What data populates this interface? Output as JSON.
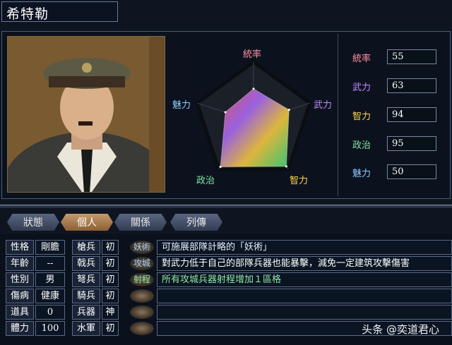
{
  "character": {
    "name": "希特勒"
  },
  "radar": {
    "labels": {
      "top": "統率",
      "right": "武力",
      "bottom_right": "智力",
      "bottom_left": "政治",
      "left": "魅力"
    },
    "label_colors": {
      "top": "#ff8fa3",
      "right": "#c08cff",
      "bottom_right": "#ffd54a",
      "bottom_left": "#7fe8a6",
      "left": "#8fcaff"
    },
    "max": 100,
    "values": [
      55,
      63,
      94,
      95,
      50
    ]
  },
  "stats": [
    {
      "label": "統率",
      "value": "55",
      "color": "#ff8fa3"
    },
    {
      "label": "武力",
      "value": "63",
      "color": "#c08cff"
    },
    {
      "label": "智力",
      "value": "94",
      "color": "#ffd54a"
    },
    {
      "label": "政治",
      "value": "95",
      "color": "#7fe8a6"
    },
    {
      "label": "魅力",
      "value": "50",
      "color": "#8fcaff"
    }
  ],
  "tabs": [
    "狀態",
    "個人",
    "關係",
    "列傳"
  ],
  "active_tab": "個人",
  "personal": [
    {
      "k": "性格",
      "v": "剛膽"
    },
    {
      "k": "年齡",
      "v": "--"
    },
    {
      "k": "性別",
      "v": "男"
    },
    {
      "k": "傷病",
      "v": "健康"
    },
    {
      "k": "道具",
      "v": "0"
    },
    {
      "k": "體力",
      "v": "100"
    }
  ],
  "aptitudes": [
    {
      "k": "槍兵",
      "v": "初"
    },
    {
      "k": "戟兵",
      "v": "初"
    },
    {
      "k": "弩兵",
      "v": "初"
    },
    {
      "k": "騎兵",
      "v": "初"
    },
    {
      "k": "兵器",
      "v": "神"
    },
    {
      "k": "水軍",
      "v": "初"
    }
  ],
  "skills": [
    {
      "tag": "妖術",
      "desc": "可施展部隊計略的「妖術」",
      "desc_color": "#e6f0ff",
      "tag_color": "#9fd0ff"
    },
    {
      "tag": "攻城",
      "desc": "對武力低于自己的部隊兵器也能暴擊，減免一定建筑攻擊傷害",
      "desc_color": "#ffffff",
      "tag_color": "#9fd0ff"
    },
    {
      "tag": "射程",
      "desc": "所有攻城兵器射程增加１區格",
      "desc_color": "#8fe8a8",
      "tag_color": "#8fe8a8"
    },
    {
      "tag": "",
      "desc": ""
    },
    {
      "tag": "",
      "desc": ""
    },
    {
      "tag": "",
      "desc": ""
    }
  ],
  "watermark": "头条 @奕道君心"
}
